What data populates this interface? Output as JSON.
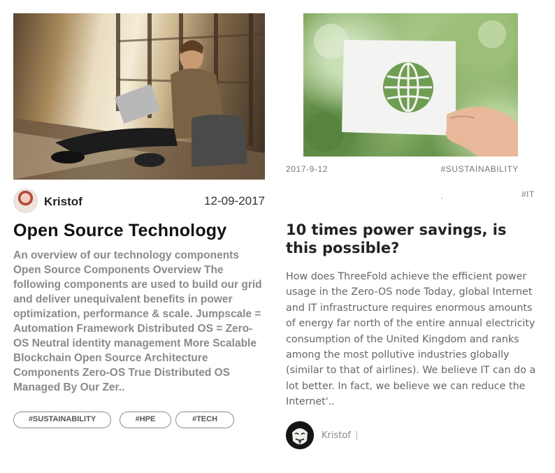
{
  "posts": [
    {
      "image": {
        "subject": "man with laptop sitting by window"
      },
      "author": {
        "name": "Kristof",
        "avatar_icon": "avatar-woman-icon"
      },
      "date": "12-09-2017",
      "title": "Open Source Technology",
      "excerpt": "An overview of our technology components Open Source Components Overview The following components are used to build our grid and deliver unequivalent benefits in power optimization, performance & scale. Jumpscale = Automation Framework Distributed OS = Zero-OS Neutral identity management More Scalable Blockchain Open Source Architecture Components Zero-OS True Distributed OS Managed By Our Zer..",
      "tags": [
        "#SUSTAINABILITY",
        "#HPE",
        "#TECH"
      ]
    },
    {
      "image": {
        "subject": "hand holding paper with globe cutout"
      },
      "date": "2017-9-12",
      "category_tag": "#SUSTAINABILITY",
      "secondary_tag": "#IT",
      "title": "10 times power savings, is this possible?",
      "excerpt": "How does ThreeFold achieve the efficient power usage in the Zero-OS node Today, global Internet and IT infrastructure requires enormous amounts of energy far north of the entire annual electricity consumption of the United Kingdom and ranks among the most pollutive industries globally (similar to that of airlines). We believe IT can do a lot better. In fact, we believe we can reduce the Internet'..",
      "author": {
        "name": "Kristof",
        "avatar_icon": "avatar-mask-icon"
      },
      "separator": "|"
    }
  ],
  "colors": {
    "title": "#111111",
    "excerpt_card1": "#8a8a8a",
    "excerpt_card2": "#666666",
    "tag_border": "#8c8c8c",
    "meta": "#777777"
  }
}
